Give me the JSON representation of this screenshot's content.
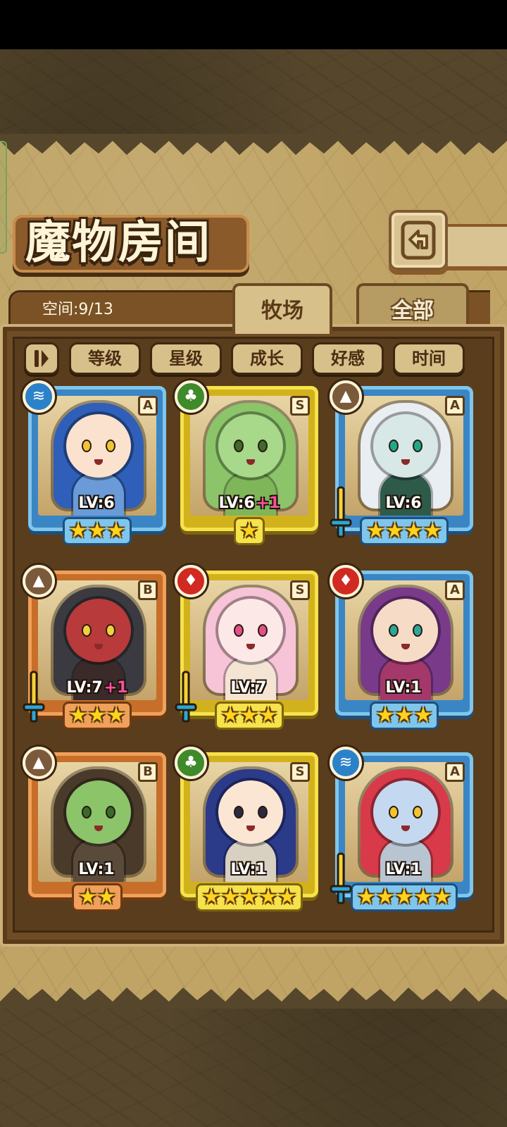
{
  "window": {
    "title": "魔物房间"
  },
  "header": {
    "title": "魔物房间",
    "back_icon": "back-arrow-icon"
  },
  "info": {
    "space_label": "空间:9/13"
  },
  "tabs": [
    {
      "label": "牧场",
      "active": true
    },
    {
      "label": "全部",
      "active": false
    }
  ],
  "sort": {
    "toggle_icon": "pause-sort-icon",
    "buttons": [
      "等级",
      "星级",
      "成长",
      "好感",
      "时间"
    ]
  },
  "monsters": [
    {
      "level": "LV:6",
      "plus": "",
      "rank": "A",
      "element": "water",
      "stars": 3,
      "frame": "blue",
      "equip": false,
      "colors": {
        "hair": "#2f5fb8",
        "skin": "#fbe2cf",
        "eye": "#f2c430",
        "cloth": "#6a9ad8"
      }
    },
    {
      "level": "LV:6",
      "plus": "+1",
      "rank": "S",
      "element": "grass",
      "stars": 1,
      "frame": "gold",
      "equip": false,
      "colors": {
        "hair": "#8cc46a",
        "skin": "#a8d88a",
        "eye": "#3f6a2a",
        "cloth": "#7fb65a"
      }
    },
    {
      "level": "LV:6",
      "plus": "",
      "rank": "A",
      "element": "earth",
      "stars": 4,
      "frame": "blue",
      "equip": true,
      "colors": {
        "hair": "#e8eef2",
        "skin": "#d8e8e6",
        "eye": "#1fa88a",
        "cloth": "#2e5a4a"
      }
    },
    {
      "level": "LV:7",
      "plus": "+1",
      "rank": "B",
      "element": "earth",
      "stars": 3,
      "frame": "orange",
      "equip": true,
      "colors": {
        "hair": "#3a3a40",
        "skin": "#b83a3a",
        "eye": "#f0d040",
        "cloth": "#3a2a2a"
      }
    },
    {
      "level": "LV:7",
      "plus": "",
      "rank": "S",
      "element": "fire",
      "stars": 3,
      "frame": "gold",
      "equip": true,
      "colors": {
        "hair": "#f6c4d6",
        "skin": "#fde8e8",
        "eye": "#e2508a",
        "cloth": "#f4e4d4"
      }
    },
    {
      "level": "LV:1",
      "plus": "",
      "rank": "A",
      "element": "fire",
      "stars": 3,
      "frame": "blue",
      "equip": false,
      "colors": {
        "hair": "#7a3a8a",
        "skin": "#f6dcc6",
        "eye": "#2aa89a",
        "cloth": "#a4386a"
      }
    },
    {
      "level": "LV:1",
      "plus": "",
      "rank": "B",
      "element": "earth",
      "stars": 2,
      "frame": "orange",
      "equip": false,
      "colors": {
        "hair": "#4a3a2a",
        "skin": "#8cc46a",
        "eye": "#3a6a2a",
        "cloth": "#5a4a3a"
      }
    },
    {
      "level": "LV:1",
      "plus": "",
      "rank": "S",
      "element": "grass",
      "stars": 5,
      "frame": "gold",
      "equip": false,
      "colors": {
        "hair": "#2c3a8a",
        "skin": "#fbe6d4",
        "eye": "#2a2a40",
        "cloth": "#d8d0c0"
      }
    },
    {
      "level": "LV:1",
      "plus": "",
      "rank": "A",
      "element": "water",
      "stars": 5,
      "frame": "blue",
      "equip": true,
      "colors": {
        "hair": "#d83a4a",
        "skin": "#c4d8f0",
        "eye": "#f2c430",
        "cloth": "#b8c4d0"
      }
    }
  ],
  "colors": {
    "panel": "#c0a466",
    "list_bg": "#5a3d1c",
    "frame_blue": "#7fc6ec",
    "frame_gold": "#f6e24a",
    "frame_orange": "#f0a05a",
    "plus_level": "#ff4fa0",
    "star": "#ffd21e"
  }
}
